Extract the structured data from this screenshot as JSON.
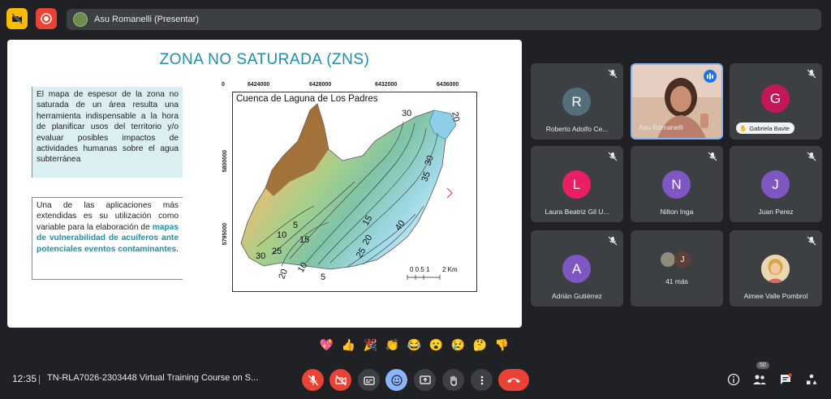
{
  "top_bar": {
    "presenter_label": "Asu Romanelli (Presentar)",
    "icons": [
      "video-off-icon",
      "record-icon"
    ]
  },
  "slide": {
    "title": "ZONA NO SATURADA (ZNS)",
    "box1_text": "El mapa de espesor de la zona no saturada de un área resulta una herramienta indispensable a la hora de planificar usos del territorio y/o evaluar posibles impactos de actividades humanas sobre el agua subterránea",
    "box2_text": "Una de las aplicaciones más extendidas es su utilización como variable para la elaboración de",
    "box2_highlight": "mapas de vulnerabilidad de acuíferos ante potenciales eventos contaminantes",
    "box2_end": ".",
    "map": {
      "title": "Cuenca de Laguna de Los Padres",
      "x_coords": [
        "6424000",
        "6428000",
        "6432000",
        "6436000"
      ],
      "y_coords": [
        "5800000",
        "5795000"
      ],
      "contours": [
        "30",
        "20",
        "35",
        "30",
        "15",
        "40",
        "20",
        "25",
        "15",
        "10",
        "5",
        "25",
        "30",
        "20",
        "10",
        "5"
      ],
      "scale_label": "0 0.5 1",
      "scale_unit": "2 Km"
    }
  },
  "participants": [
    {
      "name": "Roberto Adolfo Ce...",
      "initial": "R",
      "color": "#546e7a",
      "muted": true
    },
    {
      "name": "Asu Romanelli",
      "video": true,
      "speaking": true
    },
    {
      "name": "Gabriela Bavte",
      "initial": "G",
      "color": "#c2185b",
      "muted": true,
      "chip": true
    },
    {
      "name": "Laura Beatriz Gil U...",
      "initial": "L",
      "color": "#e91e63",
      "muted": true
    },
    {
      "name": "Nilton Inga",
      "initial": "N",
      "color": "#7e57c2",
      "muted": true
    },
    {
      "name": "Juan Perez",
      "initial": "J",
      "color": "#7e57c2",
      "muted": true
    },
    {
      "name": "Adrián Gutiérrez",
      "initial": "A",
      "color": "#7e57c2",
      "muted": true
    },
    {
      "name": "41 más",
      "others": true,
      "mini_initial": "J"
    },
    {
      "name": "Aimee Valle Pombrol",
      "photo": true,
      "muted": true
    }
  ],
  "reactions": [
    "💖",
    "👍",
    "🎉",
    "👏",
    "😂",
    "😮",
    "😢",
    "🤔",
    "👎"
  ],
  "bottom_bar": {
    "time": "12:35",
    "separator": "|",
    "meeting_title": "TN-RLA7026-2303448 Virtual Training Course on S...",
    "controls": [
      "mic-off-icon",
      "camera-off-icon",
      "captions-icon",
      "emoji-icon",
      "present-icon",
      "raise-hand-icon",
      "more-icon",
      "end-call-icon"
    ],
    "participant_count": "50",
    "right_icons": [
      "info-icon",
      "people-icon",
      "chat-icon",
      "activities-icon"
    ]
  },
  "colors": {
    "background": "#202124",
    "tile": "#3c4043",
    "accent_red": "#ea4335",
    "accent_yellow": "#fbbc04",
    "slide_title": "#1e8fa6"
  }
}
